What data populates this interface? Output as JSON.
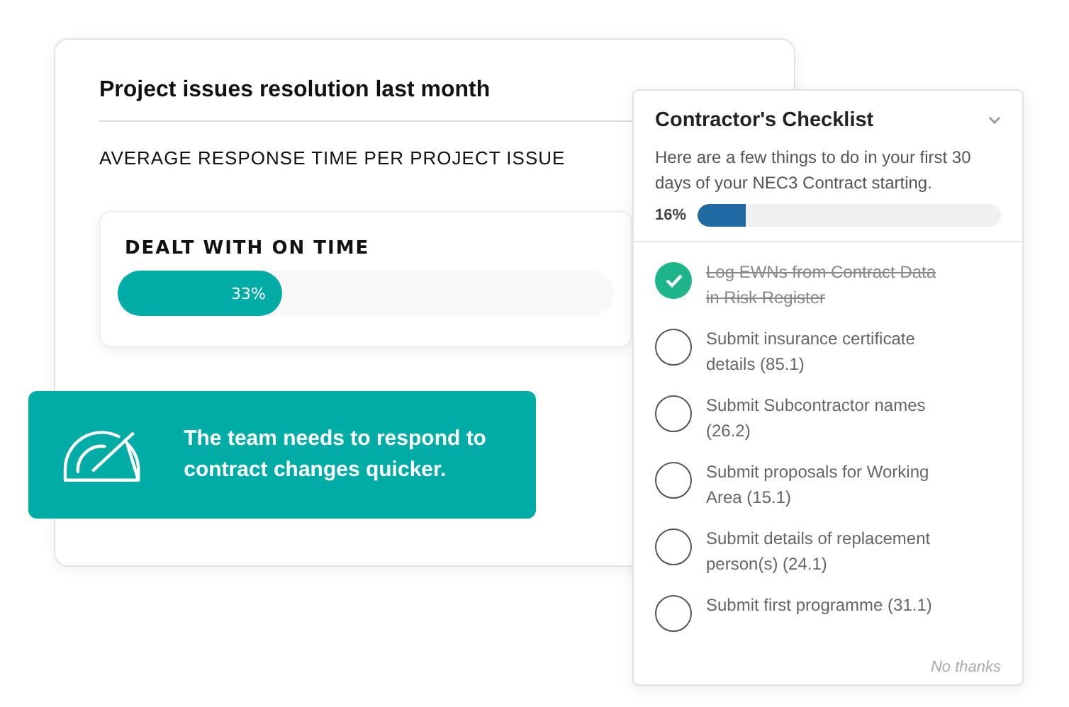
{
  "report": {
    "title": "Project issues resolution last month",
    "subtitle": "AVERAGE RESPONSE TIME PER PROJECT ISSUE",
    "metric": {
      "label": "DEALT WITH ON TIME",
      "level": 0.33,
      "reading": "33%"
    }
  },
  "callout": {
    "text": "The team needs to respond to contract changes quicker."
  },
  "checklist": {
    "title": "Contractor's Checklist",
    "description": "Here are a few things to do in your first 30 days of your NEC3 Contract starting.",
    "progress": {
      "reading": "16%",
      "level": 0.16
    },
    "items": [
      {
        "label": "Log EWNs from Contract Data in Risk Register",
        "checked": true
      },
      {
        "label": "Submit insurance certificate details (85.1)",
        "checked": false
      },
      {
        "label": "Submit Subcontractor names (26.2)",
        "checked": false
      },
      {
        "label": "Submit proposals for Working Area (15.1)",
        "checked": false
      },
      {
        "label": "Submit details of replacement person(s) (24.1)",
        "checked": false
      },
      {
        "label": "Submit first programme (31.1)",
        "checked": false
      }
    ],
    "dismiss": "No thanks"
  }
}
